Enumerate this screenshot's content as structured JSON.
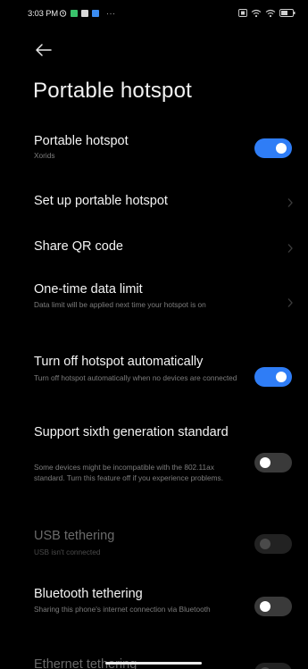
{
  "status_bar": {
    "time": "3:03 PM",
    "left_icons": [
      "alarm-icon",
      "app-notification-icon",
      "app-notification-icon",
      "app-notification-icon"
    ],
    "more": "···",
    "right_icons": [
      "nfc-icon",
      "wifi-icon",
      "signal-icon",
      "battery-icon"
    ],
    "colors": {
      "green": "#39c26b",
      "light": "#d8d8d8",
      "blue": "#3a8bf0"
    }
  },
  "header": {
    "back_icon": "arrow-left-icon",
    "title": "Portable hotspot"
  },
  "settings": [
    {
      "id": "portable-hotspot",
      "title": "Portable hotspot",
      "subtitle": "Xorids",
      "control": "toggle",
      "state": "on"
    },
    {
      "id": "set-up",
      "title": "Set up portable hotspot",
      "subtitle": "",
      "control": "chevron"
    },
    {
      "id": "share-qr",
      "title": "Share QR code",
      "subtitle": "",
      "control": "chevron"
    },
    {
      "id": "one-time-limit",
      "title": "One-time data limit",
      "subtitle": "Data limit will be applied next time your hotspot is on",
      "control": "chevron"
    },
    {
      "id": "turn-off-auto",
      "title": "Turn off hotspot automatically",
      "subtitle": "Turn off hotspot automatically when no devices are connected",
      "control": "toggle",
      "state": "on"
    },
    {
      "id": "sixth-gen",
      "title": "Support sixth generation standard",
      "subtitle": "Some devices might be incompatible with the 802.11ax standard. Turn this feature off if you experience problems.",
      "control": "toggle",
      "state": "off"
    },
    {
      "id": "usb-tethering",
      "title": "USB tethering",
      "subtitle": "USB isn't connected",
      "control": "toggle",
      "state": "off",
      "disabled": true
    },
    {
      "id": "bluetooth-tethering",
      "title": "Bluetooth tethering",
      "subtitle": "Sharing this phone's internet connection via Bluetooth",
      "control": "toggle",
      "state": "off"
    },
    {
      "id": "ethernet-tethering",
      "title": "Ethernet tethering",
      "subtitle": "",
      "control": "toggle",
      "state": "off",
      "disabled": true
    }
  ],
  "colors": {
    "accent": "#2f7df6",
    "background": "#000000",
    "subtitle": "#7d7d7d"
  }
}
